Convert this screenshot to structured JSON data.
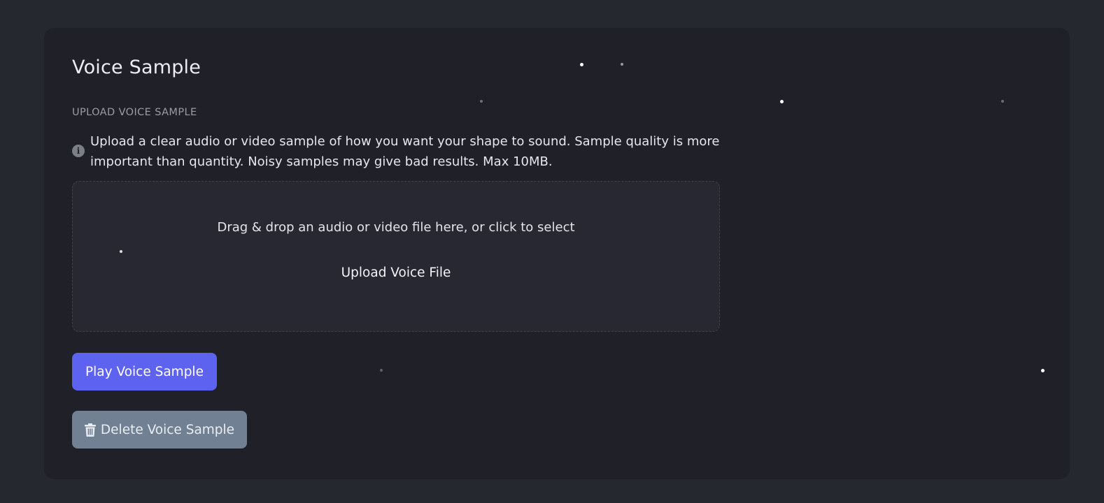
{
  "section": {
    "title": "Voice Sample",
    "upload_label": "UPLOAD VOICE SAMPLE",
    "info_icon": "info-circle-icon",
    "info_text": "Upload a clear audio or video sample of how you want your shape to sound. Sample quality is more important than quantity. Noisy samples may give bad results. Max 10MB."
  },
  "dropzone": {
    "instruction": "Drag & drop an audio or video file here, or click to select",
    "upload_label": "Upload Voice File"
  },
  "buttons": {
    "play_label": "Play Voice Sample",
    "delete_label": "Delete Voice Sample",
    "delete_icon": "trash-icon"
  },
  "colors": {
    "background": "#262830",
    "card": "#1f2028",
    "primary": "#5e63ef",
    "secondary": "#718093"
  }
}
